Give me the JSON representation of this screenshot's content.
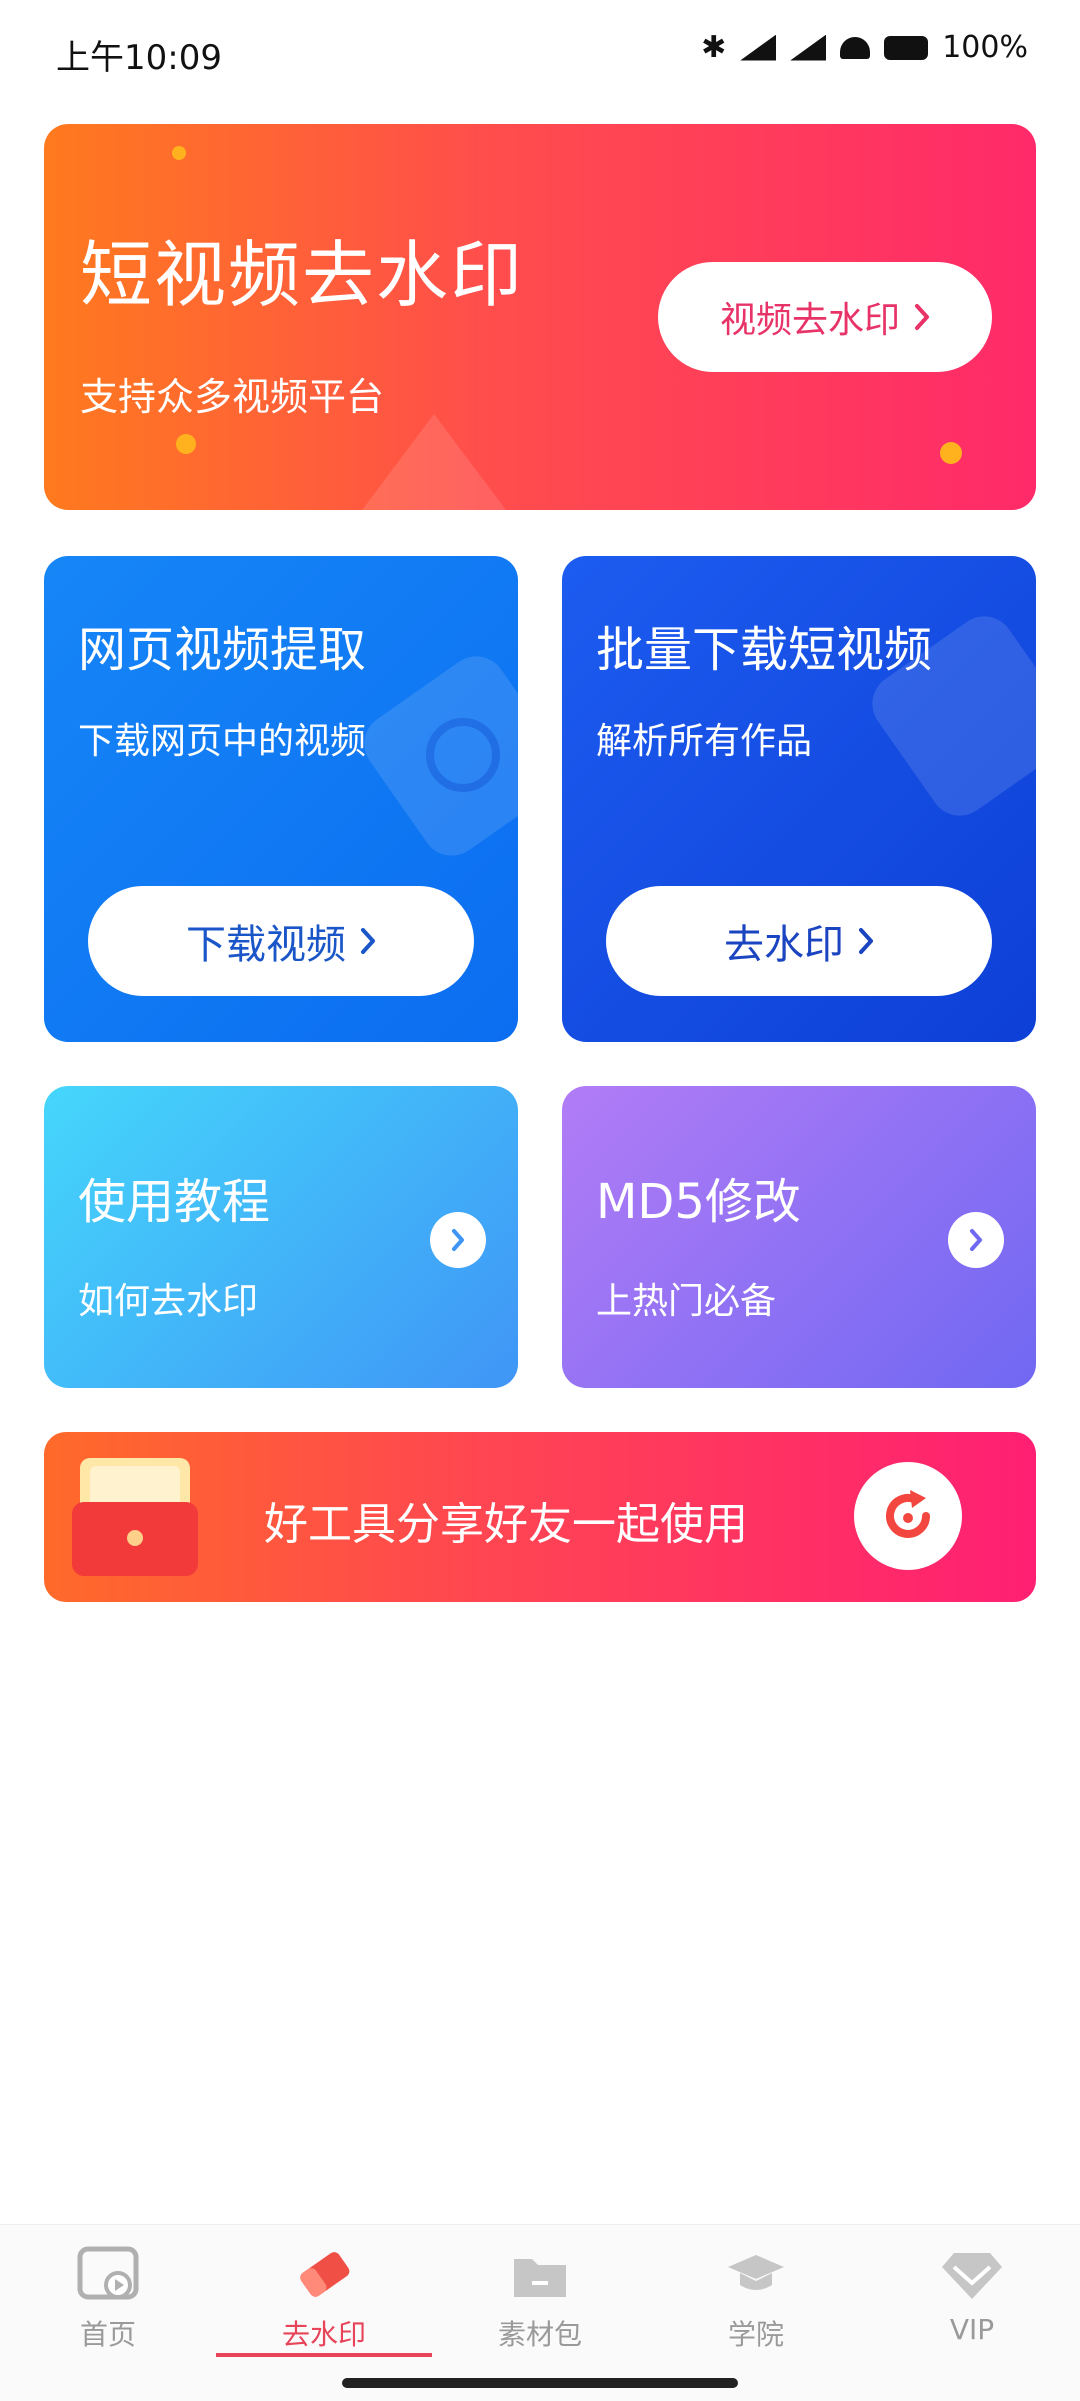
{
  "status_bar": {
    "time": "上午10:09",
    "battery": "100%"
  },
  "hero": {
    "title": "短视频去水印",
    "subtitle": "支持众多视频平台",
    "button_label": "视频去水印"
  },
  "cards": {
    "web_video": {
      "title": "网页视频提取",
      "subtitle": "下载网页中的视频",
      "button_label": "下载视频"
    },
    "batch_download": {
      "title": "批量下载短视频",
      "subtitle": "解析所有作品",
      "button_label": "去水印"
    },
    "tutorial": {
      "title": "使用教程",
      "subtitle": "如何去水印"
    },
    "md5": {
      "title": "MD5修改",
      "subtitle": "上热门必备"
    }
  },
  "share_banner": {
    "text": "好工具分享好友一起使用"
  },
  "bottom_nav": {
    "items": [
      {
        "label": "首页",
        "icon": "video-play-icon"
      },
      {
        "label": "去水印",
        "icon": "eraser-icon",
        "active": true
      },
      {
        "label": "素材包",
        "icon": "folder-icon"
      },
      {
        "label": "学院",
        "icon": "graduation-cap-icon"
      },
      {
        "label": "VIP",
        "icon": "diamond-icon"
      }
    ]
  },
  "colors": {
    "accent": "#e7445a",
    "hero_gradient": [
      "#ff7a1e",
      "#ff2a6a"
    ],
    "blue": "#0b6df0",
    "deep_blue": "#0d3fd6"
  }
}
